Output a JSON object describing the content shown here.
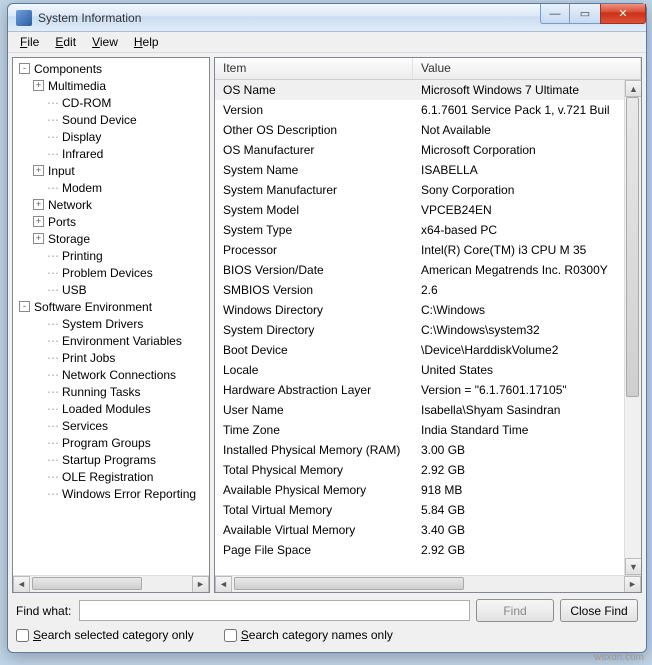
{
  "window": {
    "title": "System Information"
  },
  "menubar": {
    "items": [
      "File",
      "Edit",
      "View",
      "Help"
    ]
  },
  "tree": {
    "items": [
      {
        "depth": 0,
        "exp": "-",
        "label": "Components"
      },
      {
        "depth": 1,
        "exp": "+",
        "label": "Multimedia"
      },
      {
        "depth": 2,
        "exp": "",
        "label": "CD-ROM"
      },
      {
        "depth": 2,
        "exp": "",
        "label": "Sound Device"
      },
      {
        "depth": 2,
        "exp": "",
        "label": "Display"
      },
      {
        "depth": 2,
        "exp": "",
        "label": "Infrared"
      },
      {
        "depth": 1,
        "exp": "+",
        "label": "Input"
      },
      {
        "depth": 2,
        "exp": "",
        "label": "Modem"
      },
      {
        "depth": 1,
        "exp": "+",
        "label": "Network"
      },
      {
        "depth": 1,
        "exp": "+",
        "label": "Ports"
      },
      {
        "depth": 1,
        "exp": "+",
        "label": "Storage"
      },
      {
        "depth": 2,
        "exp": "",
        "label": "Printing"
      },
      {
        "depth": 2,
        "exp": "",
        "label": "Problem Devices"
      },
      {
        "depth": 2,
        "exp": "",
        "label": "USB"
      },
      {
        "depth": 0,
        "exp": "-",
        "label": "Software Environment"
      },
      {
        "depth": 2,
        "exp": "",
        "label": "System Drivers"
      },
      {
        "depth": 2,
        "exp": "",
        "label": "Environment Variables"
      },
      {
        "depth": 2,
        "exp": "",
        "label": "Print Jobs"
      },
      {
        "depth": 2,
        "exp": "",
        "label": "Network Connections"
      },
      {
        "depth": 2,
        "exp": "",
        "label": "Running Tasks"
      },
      {
        "depth": 2,
        "exp": "",
        "label": "Loaded Modules"
      },
      {
        "depth": 2,
        "exp": "",
        "label": "Services"
      },
      {
        "depth": 2,
        "exp": "",
        "label": "Program Groups"
      },
      {
        "depth": 2,
        "exp": "",
        "label": "Startup Programs"
      },
      {
        "depth": 2,
        "exp": "",
        "label": "OLE Registration"
      },
      {
        "depth": 2,
        "exp": "",
        "label": "Windows Error Reporting"
      }
    ]
  },
  "list": {
    "headers": {
      "item": "Item",
      "value": "Value"
    },
    "rows": [
      {
        "item": "OS Name",
        "value": "Microsoft Windows 7 Ultimate",
        "sel": true
      },
      {
        "item": "Version",
        "value": "6.1.7601 Service Pack 1, v.721 Buil"
      },
      {
        "item": "Other OS Description",
        "value": "Not Available"
      },
      {
        "item": "OS Manufacturer",
        "value": "Microsoft Corporation"
      },
      {
        "item": "System Name",
        "value": "ISABELLA"
      },
      {
        "item": "System Manufacturer",
        "value": "Sony Corporation"
      },
      {
        "item": "System Model",
        "value": "VPCEB24EN"
      },
      {
        "item": "System Type",
        "value": "x64-based PC"
      },
      {
        "item": "Processor",
        "value": "Intel(R) Core(TM) i3 CPU       M 35"
      },
      {
        "item": "BIOS Version/Date",
        "value": "American Megatrends Inc. R0300Y"
      },
      {
        "item": "SMBIOS Version",
        "value": "2.6"
      },
      {
        "item": "Windows Directory",
        "value": "C:\\Windows"
      },
      {
        "item": "System Directory",
        "value": "C:\\Windows\\system32"
      },
      {
        "item": "Boot Device",
        "value": "\\Device\\HarddiskVolume2"
      },
      {
        "item": "Locale",
        "value": "United States"
      },
      {
        "item": "Hardware Abstraction Layer",
        "value": "Version = \"6.1.7601.17105\""
      },
      {
        "item": "User Name",
        "value": "Isabella\\Shyam Sasindran"
      },
      {
        "item": "Time Zone",
        "value": "India Standard Time"
      },
      {
        "item": "Installed Physical Memory (RAM)",
        "value": "3.00 GB"
      },
      {
        "item": "Total Physical Memory",
        "value": "2.92 GB"
      },
      {
        "item": "Available Physical Memory",
        "value": "918 MB"
      },
      {
        "item": "Total Virtual Memory",
        "value": "5.84 GB"
      },
      {
        "item": "Available Virtual Memory",
        "value": "3.40 GB"
      },
      {
        "item": "Page File Space",
        "value": "2.92 GB"
      }
    ]
  },
  "find": {
    "label": "Find what:",
    "value": "",
    "placeholder": "",
    "find_button": "Find",
    "close_button": "Close Find",
    "check1": "Search selected category only",
    "check2": "Search category names only"
  },
  "watermark": "wsxdn.com"
}
